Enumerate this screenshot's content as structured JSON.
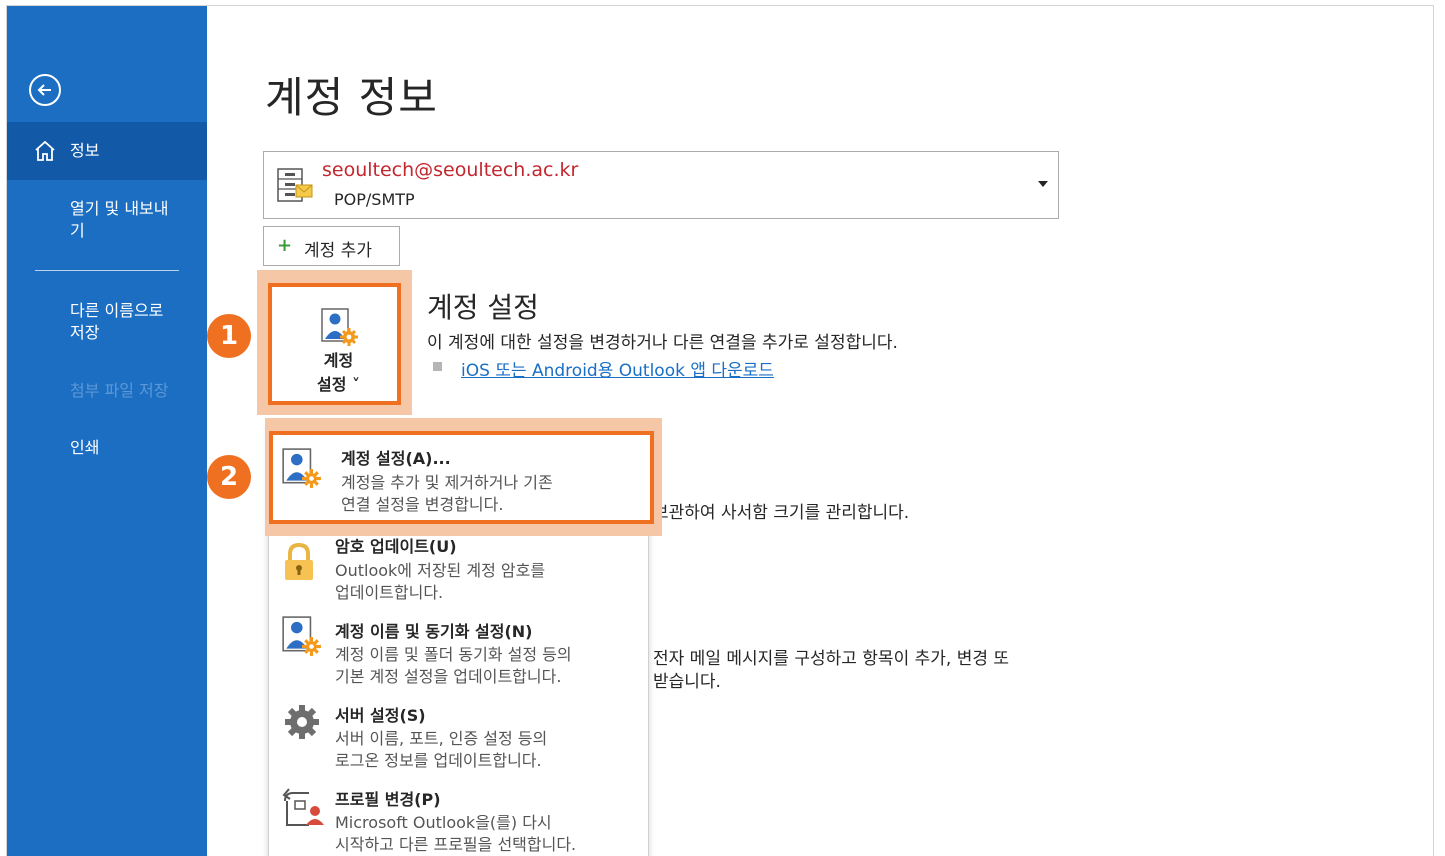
{
  "sidebar": {
    "back_icon": "back-arrow-icon",
    "items": [
      {
        "label": "정보",
        "icon": "home-icon"
      },
      {
        "label": "열기 및 내보내\n기"
      },
      {
        "label": "다른 이름으로\n저장"
      },
      {
        "label": "첨부 파일 저장"
      },
      {
        "label": "인쇄"
      }
    ]
  },
  "main": {
    "title": "계정 정보",
    "account": {
      "email": "seoultech@seoultech.ac.kr",
      "type": "POP/SMTP"
    },
    "add_account_label": "계정 추가",
    "account_settings_button": {
      "line1": "계정",
      "line2": "설정 ˅"
    },
    "section": {
      "title": "계정 설정",
      "desc": "이 계정에 대한 설정을 변경하거나 다른 연결을 추가로 설정합니다.",
      "link": "iOS 또는 Android용 Outlook 앱 다운로드"
    },
    "background_text": {
      "mailbox": "보관하여 사서함 크기를 관리합니다.",
      "rules1": "전자 메일 메시지를 구성하고 항목이 추가, 변경 또",
      "rules2": "받습니다."
    }
  },
  "badges": {
    "step1": "1",
    "step2": "2"
  },
  "menu": [
    {
      "title": "계정 설정(A)...",
      "desc1": "계정을 추가 및 제거하거나 기존",
      "desc2": "연결 설정을 변경합니다.",
      "icon": "account-settings-icon"
    },
    {
      "title": "암호 업데이트(U)",
      "desc1": "Outlook에 저장된 계정 암호를",
      "desc2": "업데이트합니다.",
      "icon": "lock-icon"
    },
    {
      "title": "계정 이름 및 동기화 설정(N)",
      "desc1": "계정 이름 및 폴더 동기화 설정 등의",
      "desc2": "기본 계정 설정을 업데이트합니다.",
      "icon": "account-sync-icon"
    },
    {
      "title": "서버 설정(S)",
      "desc1": "서버 이름, 포트, 인증 설정 등의",
      "desc2": "로그온 정보를 업데이트합니다.",
      "icon": "gear-icon"
    },
    {
      "title": "프로필 변경(P)",
      "desc1": "Microsoft Outlook을(를) 다시",
      "desc2": "시작하고 다른 프로필을 선택합니다.",
      "icon": "profile-switch-icon"
    }
  ],
  "colors": {
    "sidebar": "#1b6ec2",
    "sidebar_active": "#125aa8",
    "highlight": "#f07022",
    "email": "#c4262e",
    "link": "#1a6fc5"
  }
}
